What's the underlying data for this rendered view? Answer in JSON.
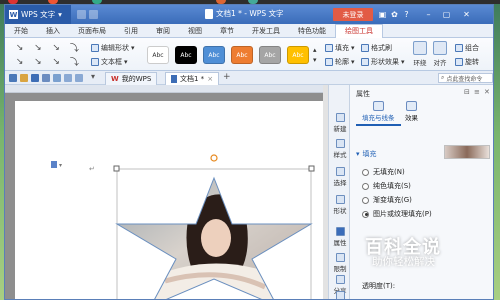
{
  "window": {
    "app_name": "WPS 文字",
    "doc_title": "文档1 * - WPS 文字",
    "login_label": "未登录"
  },
  "ribbon_tabs": [
    "开始",
    "插入",
    "页面布局",
    "引用",
    "审阅",
    "视图",
    "章节",
    "开发工具",
    "特色功能",
    "绘图工具"
  ],
  "ribbon": {
    "edit_shape": "编辑形状",
    "text_box": "文本框",
    "style_label": "Abc",
    "swatch_colors": [
      "#ffffff",
      "#000000",
      "#4f8fd6",
      "#ee7d31",
      "#a5a5a5",
      "#ffc000"
    ],
    "fill": "填充",
    "format_brush": "格式刷",
    "outline": "轮廓",
    "shape_effects": "形状效果",
    "wrap": "环绕",
    "align": "对齐",
    "group": "组合",
    "rotate": "旋转"
  },
  "doc_tabs": [
    {
      "label": "我的WPS",
      "icon": "wps-logo-icon"
    },
    {
      "label": "文档1 *",
      "icon": "document-icon"
    }
  ],
  "search": {
    "placeholder": "点此查找命令"
  },
  "tool_strip": [
    "新建",
    "样式",
    "选择",
    "形状",
    "属性",
    "限制",
    "分享",
    "协作"
  ],
  "pane": {
    "title": "属性",
    "tabs": [
      "填充与线条",
      "效果"
    ],
    "section": "填充",
    "options": [
      "无填充(N)",
      "纯色填充(S)",
      "渐变填充(G)",
      "图片或纹理填充(P)"
    ],
    "selected_option": 3,
    "transparency_label": "透明度(T):"
  },
  "watermark": {
    "title": "百科全说",
    "subtitle": "助你轻松解决"
  },
  "colors": {
    "title_bar": "#3a6cb9",
    "active_tab": "#c8302b",
    "accent": "#1f5fb4"
  }
}
